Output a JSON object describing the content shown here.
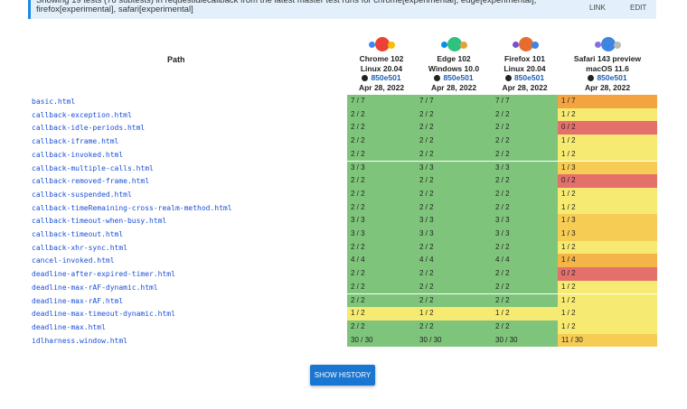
{
  "banner": {
    "text": "Showing 19 tests (76 subtests) in requestidlecallback from the latest master test runs for chrome[experimental], edge[experimental], firefox[experimental], safari[experimental]",
    "link_label": "LINK",
    "edit_label": "EDIT"
  },
  "table": {
    "path_header": "Path",
    "browsers": [
      {
        "name": "Chrome 102",
        "os": "Linux 20.04",
        "sha": "850e501",
        "date": "Apr 28, 2022",
        "icon": "chrome-icon"
      },
      {
        "name": "Edge 102",
        "os": "Windows 10.0",
        "sha": "850e501",
        "date": "Apr 28, 2022",
        "icon": "edge-icon"
      },
      {
        "name": "Firefox 101",
        "os": "Linux 20.04",
        "sha": "850e501",
        "date": "Apr 28, 2022",
        "icon": "firefox-icon"
      },
      {
        "name": "Safari 143 preview",
        "os": "macOS 11.6",
        "sha": "850e501",
        "date": "Apr 28, 2022",
        "icon": "safari-icon"
      }
    ],
    "rows": [
      {
        "path": "basic.html",
        "results": [
          "7 / 7",
          "7 / 7",
          "7 / 7",
          "1 / 7"
        ]
      },
      {
        "path": "callback-exception.html",
        "results": [
          "2 / 2",
          "2 / 2",
          "2 / 2",
          "1 / 2"
        ]
      },
      {
        "path": "callback-idle-periods.html",
        "results": [
          "2 / 2",
          "2 / 2",
          "2 / 2",
          "0 / 2"
        ]
      },
      {
        "path": "callback-iframe.html",
        "results": [
          "2 / 2",
          "2 / 2",
          "2 / 2",
          "1 / 2"
        ]
      },
      {
        "path": "callback-invoked.html",
        "results": [
          "2 / 2",
          "2 / 2",
          "2 / 2",
          "1 / 2"
        ]
      },
      {
        "path": "callback-multiple-calls.html",
        "results": [
          "3 / 3",
          "3 / 3",
          "3 / 3",
          "1 / 3"
        ]
      },
      {
        "path": "callback-removed-frame.html",
        "results": [
          "2 / 2",
          "2 / 2",
          "2 / 2",
          "0 / 2"
        ]
      },
      {
        "path": "callback-suspended.html",
        "results": [
          "2 / 2",
          "2 / 2",
          "2 / 2",
          "1 / 2"
        ]
      },
      {
        "path": "callback-timeRemaining-cross-realm-method.html",
        "results": [
          "2 / 2",
          "2 / 2",
          "2 / 2",
          "1 / 2"
        ]
      },
      {
        "path": "callback-timeout-when-busy.html",
        "results": [
          "3 / 3",
          "3 / 3",
          "3 / 3",
          "1 / 3"
        ]
      },
      {
        "path": "callback-timeout.html",
        "results": [
          "3 / 3",
          "3 / 3",
          "3 / 3",
          "1 / 3"
        ]
      },
      {
        "path": "callback-xhr-sync.html",
        "results": [
          "2 / 2",
          "2 / 2",
          "2 / 2",
          "1 / 2"
        ]
      },
      {
        "path": "cancel-invoked.html",
        "results": [
          "4 / 4",
          "4 / 4",
          "4 / 4",
          "1 / 4"
        ]
      },
      {
        "path": "deadline-after-expired-timer.html",
        "results": [
          "2 / 2",
          "2 / 2",
          "2 / 2",
          "0 / 2"
        ]
      },
      {
        "path": "deadline-max-rAF-dynamic.html",
        "results": [
          "2 / 2",
          "2 / 2",
          "2 / 2",
          "1 / 2"
        ]
      },
      {
        "path": "deadline-max-rAF.html",
        "results": [
          "2 / 2",
          "2 / 2",
          "2 / 2",
          "1 / 2"
        ]
      },
      {
        "path": "deadline-max-timeout-dynamic.html",
        "results": [
          "1 / 2",
          "1 / 2",
          "1 / 2",
          "1 / 2"
        ]
      },
      {
        "path": "deadline-max.html",
        "results": [
          "2 / 2",
          "2 / 2",
          "2 / 2",
          "1 / 2"
        ]
      },
      {
        "path": "idlharness.window.html",
        "results": [
          "30 / 30",
          "30 / 30",
          "30 / 30",
          "11 / 30"
        ]
      }
    ]
  },
  "colors": {
    "pass": "#7ec47a",
    "half": "#f6ea72",
    "third": "#f6cc55",
    "quarter": "#f5b447",
    "seventh": "#f3a340",
    "fail": "#e4706c",
    "low": "#f3aa4a"
  },
  "show_history_label": "SHOW HISTORY"
}
